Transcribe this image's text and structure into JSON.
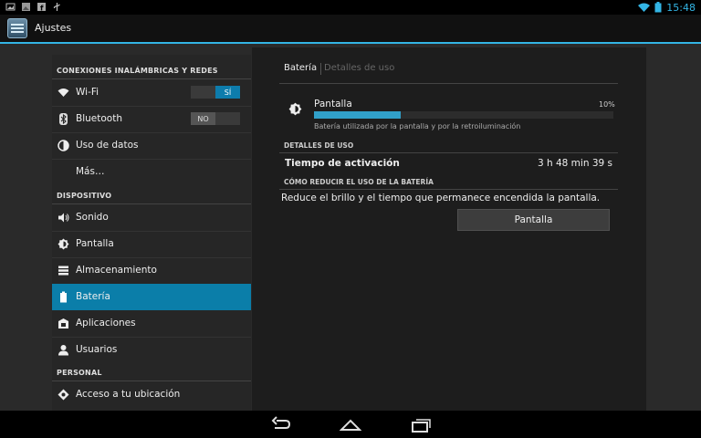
{
  "status": {
    "time": "15:48",
    "left_icons": [
      "screenshot-icon",
      "gallery-icon",
      "facebook-icon",
      "usb-icon"
    ],
    "right_icons": [
      "wifi-icon",
      "battery-icon"
    ]
  },
  "actionbar": {
    "title": "Ajustes"
  },
  "colors": {
    "accent": "#33b5e5",
    "selected": "#0b7ea9"
  },
  "sidebar": {
    "sections": [
      {
        "header": "CONEXIONES INALÁMBRICAS Y REDES",
        "items": [
          {
            "label": "Wi-Fi",
            "icon": "wifi-icon",
            "toggle": "SÍ",
            "toggle_state": "on"
          },
          {
            "label": "Bluetooth",
            "icon": "bluetooth-icon",
            "toggle": "NO",
            "toggle_state": "off"
          },
          {
            "label": "Uso de datos",
            "icon": "data-usage-icon"
          },
          {
            "label": "Más…"
          }
        ]
      },
      {
        "header": "DISPOSITIVO",
        "items": [
          {
            "label": "Sonido",
            "icon": "sound-icon"
          },
          {
            "label": "Pantalla",
            "icon": "display-icon"
          },
          {
            "label": "Almacenamiento",
            "icon": "storage-icon"
          },
          {
            "label": "Batería",
            "icon": "battery-icon",
            "selected": true
          },
          {
            "label": "Aplicaciones",
            "icon": "apps-icon"
          },
          {
            "label": "Usuarios",
            "icon": "users-icon"
          }
        ]
      },
      {
        "header": "PERSONAL",
        "items": [
          {
            "label": "Acceso a tu ubicación",
            "icon": "location-icon"
          }
        ]
      }
    ]
  },
  "detail": {
    "breadcrumb": [
      "Batería",
      "Detalles de uso"
    ],
    "app": {
      "name": "Pantalla",
      "percent": "10%",
      "usage_fraction": 0.29,
      "description": "Batería utilizada por la pantalla y por la retroiluminación"
    },
    "usage_header": "DETALLES DE USO",
    "usage_label": "Tiempo de activación",
    "usage_value": "3 h 48 min 39 s",
    "reduce_header": "CÓMO REDUCIR EL USO DE LA BATERÍA",
    "reduce_text": "Reduce el brillo y el tiempo que permanece encendida la pantalla.",
    "reduce_button": "Pantalla"
  },
  "navbar": [
    "back-icon",
    "home-icon",
    "recents-icon"
  ]
}
